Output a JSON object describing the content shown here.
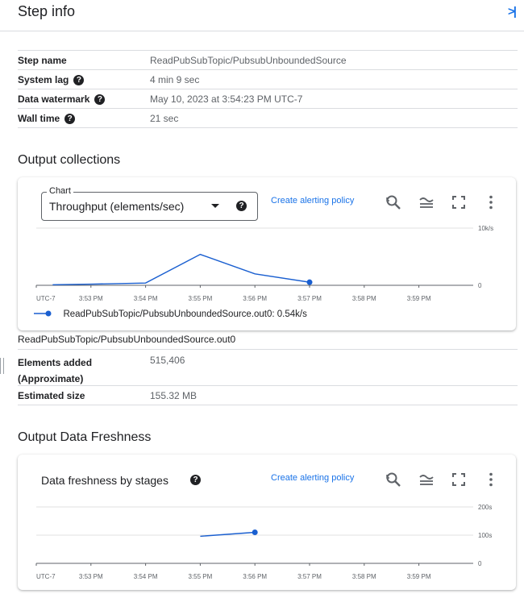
{
  "header": {
    "title": "Step info",
    "collapse_icon": "collapse-panel-icon",
    "collapse_glyph": ">|"
  },
  "step_info": {
    "rows": [
      {
        "label": "Step name",
        "value": "ReadPubSubTopic/PubsubUnboundedSource",
        "help": false
      },
      {
        "label": "System lag",
        "value": "4 min 9 sec",
        "help": true
      },
      {
        "label": "Data watermark",
        "value": "May 10, 2023 at 3:54:23 PM UTC-7",
        "help": true
      },
      {
        "label": "Wall time",
        "value": "21 sec",
        "help": true
      }
    ],
    "help_glyph": "?"
  },
  "output_collections": {
    "title": "Output collections",
    "chart_select_label": "Chart",
    "chart_select_value": "Throughput (elements/sec)",
    "create_policy": "Create alerting policy",
    "legend": "ReadPubSubTopic/PubsubUnboundedSource.out0:  0.54k/s",
    "collection_name": "ReadPubSubTopic/PubsubUnboundedSource.out0",
    "details": [
      {
        "label": "Elements added\n(Approximate)",
        "value": "515,406"
      },
      {
        "label": "Estimated size",
        "value": "155.32 MB"
      }
    ]
  },
  "freshness": {
    "title": "Output Data Freshness",
    "card_title": "Data freshness by stages",
    "create_policy": "Create alerting policy"
  },
  "colors": {
    "accent": "#1a73e8",
    "series": "#1a5fd0",
    "divider": "#dadce0"
  },
  "chart_data": [
    {
      "type": "line",
      "title": "Throughput (elements/sec)",
      "x": [
        "3:52 PM",
        "3:53 PM",
        "3:54 PM",
        "3:55 PM",
        "3:56 PM",
        "3:57 PM"
      ],
      "tick_labels": [
        "UTC-7",
        "3:53 PM",
        "3:54 PM",
        "3:55 PM",
        "3:56 PM",
        "3:57 PM",
        "3:58 PM",
        "3:59 PM"
      ],
      "y_tick_labels": [
        "10k/s",
        "0"
      ],
      "ylim": [
        0,
        10000
      ],
      "series": [
        {
          "name": "ReadPubSubTopic/PubsubUnboundedSource.out0",
          "values": [
            100,
            200,
            400,
            5400,
            2000,
            540
          ]
        }
      ]
    },
    {
      "type": "line",
      "title": "Data freshness by stages",
      "x": [
        "3:55 PM",
        "3:56 PM"
      ],
      "tick_labels": [
        "UTC-7",
        "3:53 PM",
        "3:54 PM",
        "3:55 PM",
        "3:56 PM",
        "3:57 PM",
        "3:58 PM",
        "3:59 PM"
      ],
      "y_tick_labels": [
        "200s",
        "100s",
        "0"
      ],
      "ylim": [
        0,
        200
      ],
      "series": [
        {
          "values": [
            96,
            110
          ]
        }
      ]
    }
  ]
}
